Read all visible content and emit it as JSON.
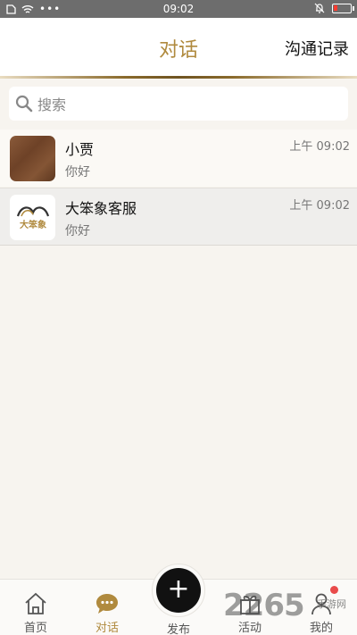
{
  "status_bar": {
    "time": "09:02"
  },
  "header": {
    "title": "对话",
    "records_label": "沟通记录"
  },
  "search": {
    "placeholder": "搜索"
  },
  "conversations": [
    {
      "name": "小贾",
      "message": "你好",
      "time": "上午 09:02"
    },
    {
      "name": "大笨象客服",
      "message": "你好",
      "time": "上午 09:02",
      "logo_text": "大笨象"
    }
  ],
  "bottom_nav": {
    "tabs": [
      {
        "label": "首页",
        "icon": "home-icon"
      },
      {
        "label": "对话",
        "icon": "chat-bubble-icon",
        "active": true
      },
      {
        "label": "发布",
        "icon": "plus-icon"
      },
      {
        "label": "活动",
        "icon": "gift-icon"
      },
      {
        "label": "我的",
        "icon": "user-icon"
      }
    ]
  },
  "watermark": {
    "text": "2265",
    "sub": "手游网"
  },
  "colors": {
    "accent": "#b08a3e",
    "badge": "#e94b4b",
    "status_bar": "#6d6d6d"
  }
}
